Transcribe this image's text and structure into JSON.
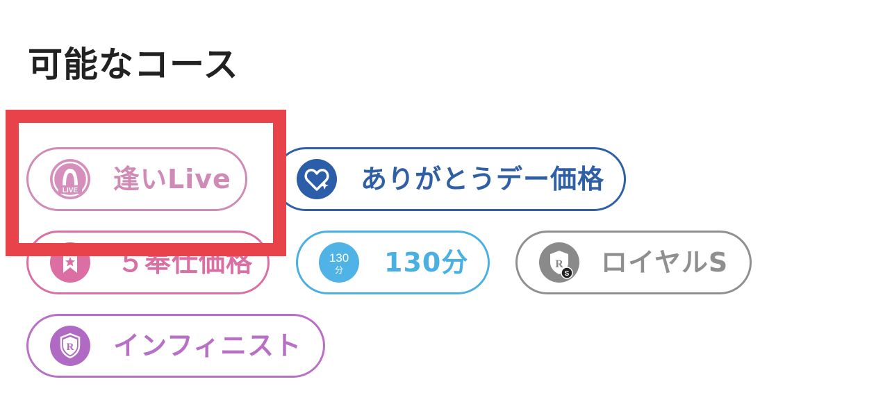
{
  "section": {
    "title": "可能なコース"
  },
  "courses": [
    {
      "label": "逢いLive",
      "icon": "live-woman-icon",
      "icon_text": "LIVE",
      "color": "#cf8bb6",
      "icon_bg": "#d68fbd",
      "highlighted": true
    },
    {
      "label": "ありがとうデー価格",
      "icon": "heart-sparkle-icon",
      "color": "#2f5fa5",
      "icon_bg": "#2c5da8"
    },
    {
      "label": "５奉仕価格",
      "icon": "star-bookmark-icon",
      "color": "#d96fa3",
      "icon_bg": "#db6ea3"
    },
    {
      "label": "130分",
      "icon": "time-130-icon",
      "icon_text": "130",
      "icon_subtext": "分",
      "color": "#4ab0e2",
      "icon_bg": "#4fb3e6"
    },
    {
      "label": "ロイヤルS",
      "icon": "royal-s-shield-icon",
      "icon_text": "R",
      "icon_subtext": "S",
      "color": "#8f8f8f",
      "icon_bg": "#8a8a8a"
    },
    {
      "label": "インフィニスト",
      "icon": "r-shield-icon",
      "icon_text": "R",
      "color": "#b86fc6",
      "icon_bg": "#b16ac4"
    }
  ],
  "highlight": {
    "color": "#e8434a",
    "target": "逢いLive"
  }
}
